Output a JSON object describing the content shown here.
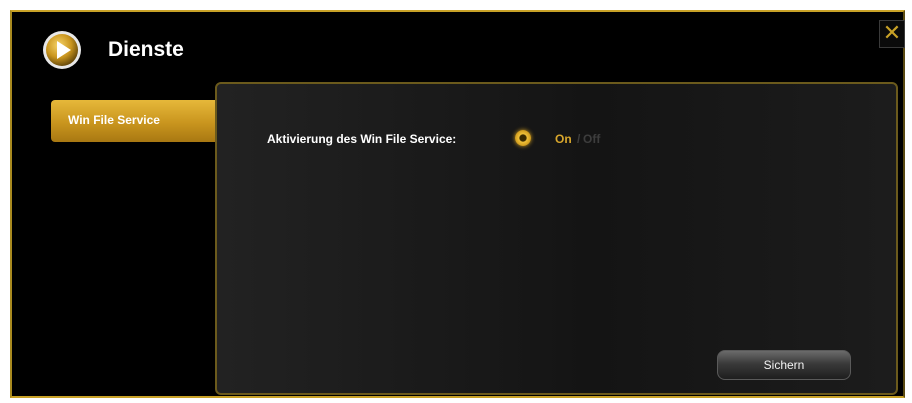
{
  "window": {
    "title": "Dienste",
    "close_label": "✕"
  },
  "sidebar": {
    "items": [
      {
        "label": "Win File Service",
        "selected": true
      }
    ]
  },
  "panel": {
    "setting_label": "Aktivierung des Win File Service:",
    "options": {
      "on": "On",
      "separator": "/",
      "off": "Off",
      "selected": "On"
    },
    "save_label": "Sichern"
  },
  "colors": {
    "accent": "#c9a227",
    "tab_gold": "#d4a020",
    "background": "#000000"
  },
  "icons": {
    "title": "play-circle-icon",
    "close": "close-icon"
  }
}
